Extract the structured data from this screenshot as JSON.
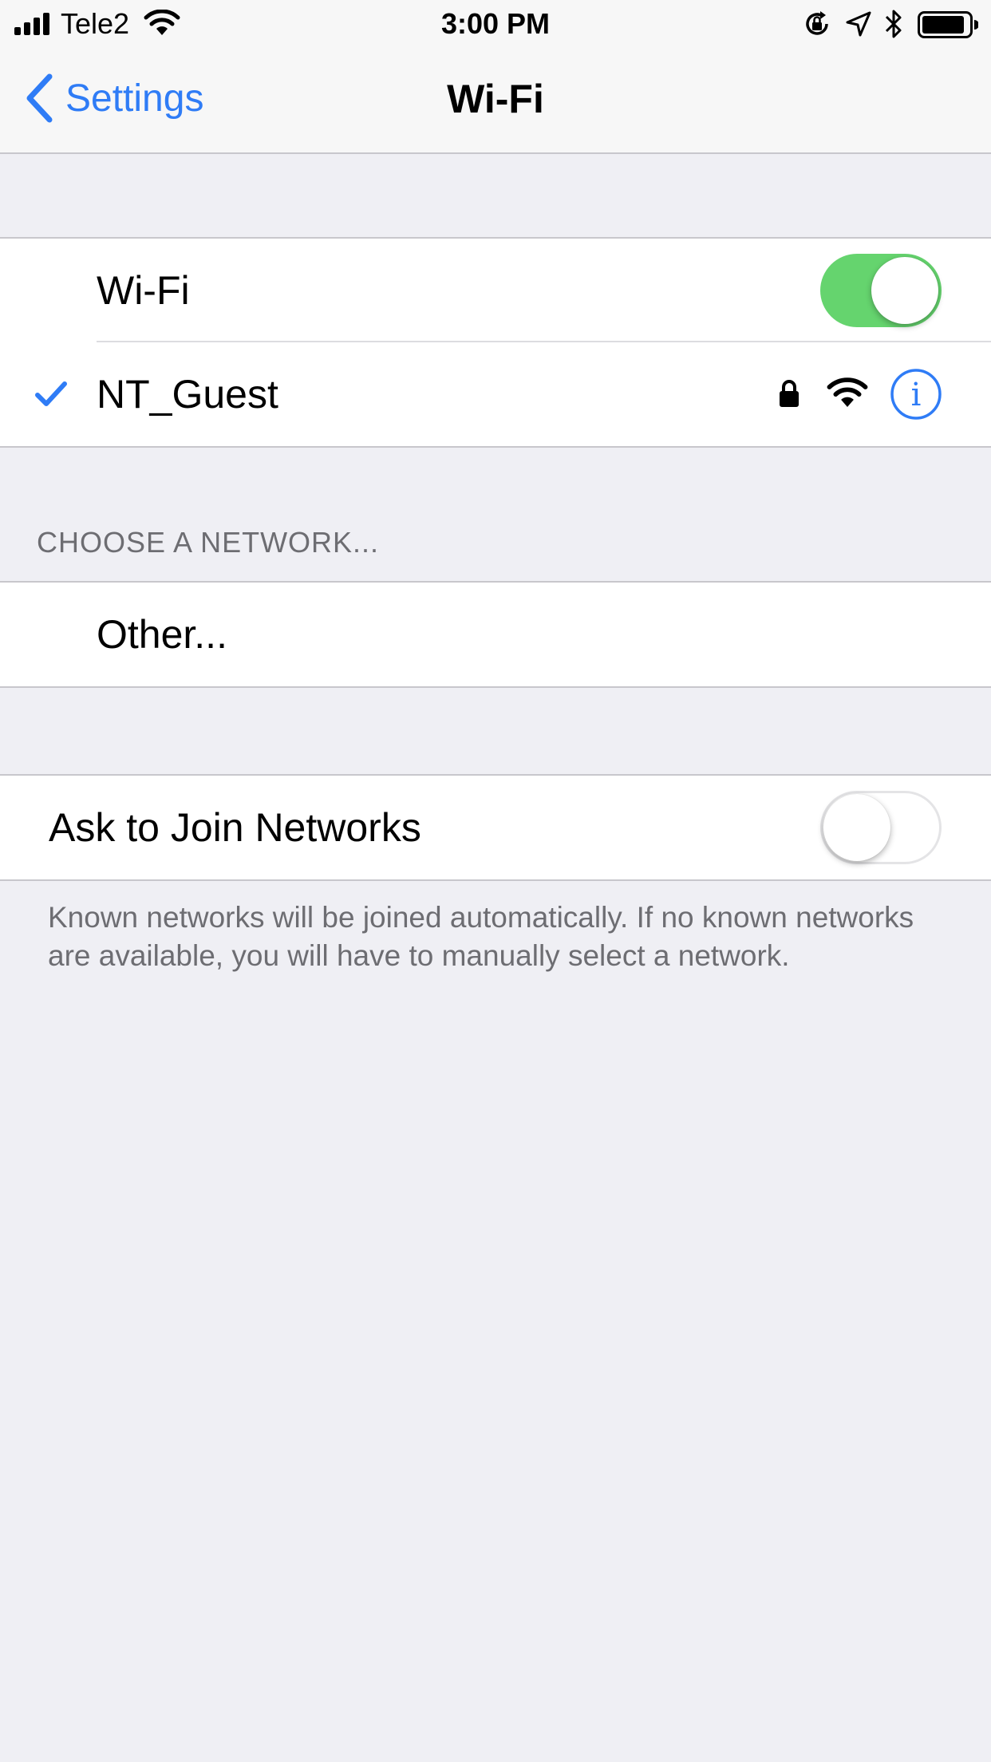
{
  "status_bar": {
    "carrier": "Tele2",
    "time": "3:00 PM",
    "icons": [
      "signal-icon",
      "wifi-icon",
      "orientation-lock-icon",
      "location-icon",
      "bluetooth-icon",
      "battery-icon"
    ]
  },
  "nav": {
    "back_label": "Settings",
    "title": "Wi-Fi"
  },
  "wifi_group": {
    "wifi_label": "Wi-Fi",
    "wifi_enabled": true,
    "connected_network": "NT_Guest",
    "icons": [
      "checkmark-icon",
      "lock-icon",
      "wifi-signal-icon",
      "info-icon"
    ]
  },
  "choose_section": {
    "header": "CHOOSE A NETWORK...",
    "other_label": "Other..."
  },
  "ask_group": {
    "label": "Ask to Join Networks",
    "enabled": false,
    "footer": "Known networks will be joined automatically. If no known networks are available, you will have to manually select a network."
  },
  "colors": {
    "accent": "#2f7cf6",
    "toggle_on": "#65d46e",
    "background": "#efeff4"
  }
}
